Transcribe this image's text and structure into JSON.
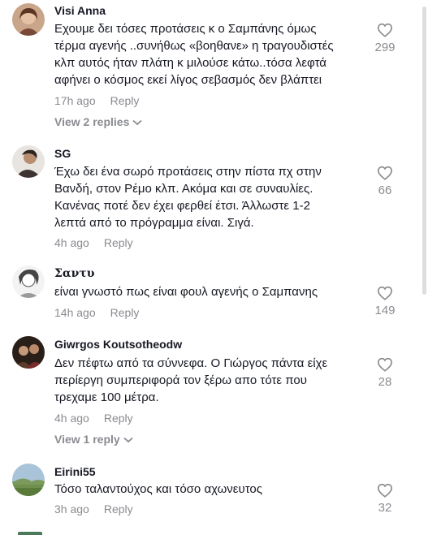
{
  "comments": [
    {
      "username": "Visi Anna",
      "lines": [
        "Εχουμε δει τόσες προτάσεις κ ο Σαμπάνης όμως",
        "τέρμα αγενής ..συνήθως «βοηθανε» η τραγουδιστές",
        "κλπ αυτός ήταν πλάτη κ μιλούσε κάτω..τόσα λεφτά",
        "αφήνει ο κόσμος εκεί λίγος σεβασμός δεν βλάπτει"
      ],
      "time": "17h ago",
      "reply_label": "Reply",
      "likes": "299",
      "view_replies": "View 2 replies"
    },
    {
      "username": "SG",
      "lines": [
        "Έχω δει ένα σωρό προτάσεις στην πίστα πχ στην",
        "Βανδή, στον Ρέμο κλπ. Ακόμα και σε συναυλίες.",
        "Κανένας ποτέ δεν έχει φερθεί έτσι. Άλλωστε 1-2",
        "λεπτά από το πρόγραμμα είναι. Σιγά."
      ],
      "time": "4h ago",
      "reply_label": "Reply",
      "likes": "66"
    },
    {
      "username": "Σαντυ",
      "lines": [
        "είναι γνωστό πως είναι φουλ αγενής ο Σαμπανης"
      ],
      "time": "14h ago",
      "reply_label": "Reply",
      "likes": "149"
    },
    {
      "username": "Giwrgos Koutsotheodw",
      "lines": [
        "Δεν πέφτω από τα σύννεφα. Ο Γιώργος πάντα είχε",
        "περίεργη συμπεριφορά τον ξέρω απο τότε που",
        "τρεχαμε 100 μέτρα."
      ],
      "time": "4h ago",
      "reply_label": "Reply",
      "likes": "28",
      "view_replies": "View 1 reply"
    },
    {
      "username": "Eirini55",
      "lines": [
        "Τόσο ταλαντούχος και τόσο αχωνευτος"
      ],
      "time": "3h ago",
      "reply_label": "Reply",
      "likes": "32"
    }
  ],
  "colors": {
    "text": "#161823",
    "muted": "#8a8b91"
  }
}
